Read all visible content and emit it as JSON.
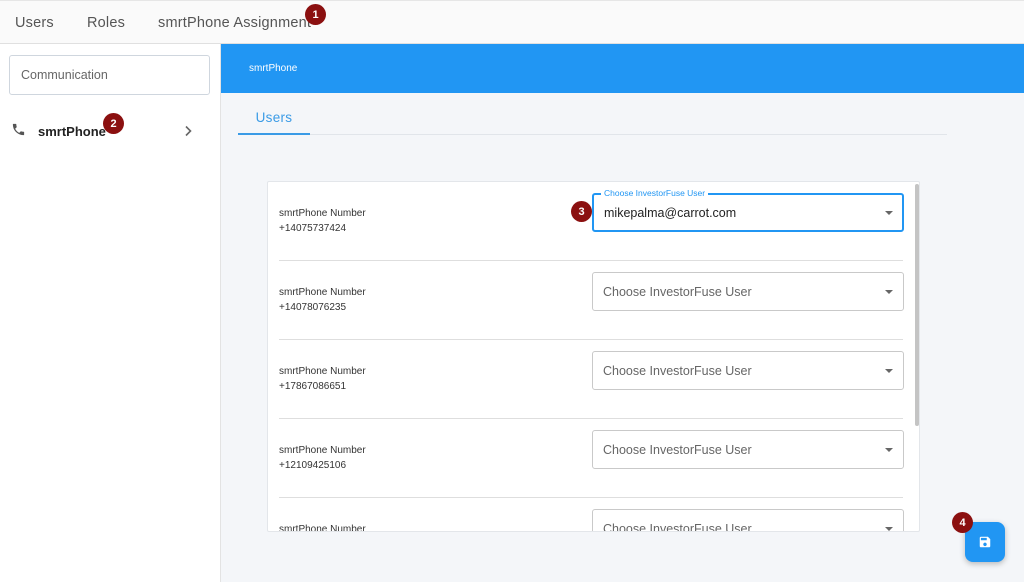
{
  "top_tabs": [
    {
      "label": "Users"
    },
    {
      "label": "Roles"
    },
    {
      "label": "smrtPhone Assignment"
    }
  ],
  "markers": [
    "1",
    "2",
    "3",
    "4"
  ],
  "sidebar": {
    "search_placeholder": "Communication",
    "items": [
      {
        "label": "smrtPhone",
        "icon": "phone-icon"
      }
    ]
  },
  "main": {
    "header_title": "smrtPhone",
    "tab_label": "Users",
    "select_label": "Choose InvestorFuse User",
    "rows": [
      {
        "label": "smrtPhone Number",
        "number": "+14075737424",
        "selected": "mikepalma@carrot.com"
      },
      {
        "label": "smrtPhone Number",
        "number": "+14078076235",
        "selected": "Choose InvestorFuse User"
      },
      {
        "label": "smrtPhone Number",
        "number": "+17867086651",
        "selected": "Choose InvestorFuse User"
      },
      {
        "label": "smrtPhone Number",
        "number": "+12109425106",
        "selected": "Choose InvestorFuse User"
      },
      {
        "label": "smrtPhone Number",
        "number": "",
        "selected": "Choose InvestorFuse User"
      }
    ]
  },
  "colors": {
    "accent": "#2196f3",
    "marker": "#8b1010"
  }
}
